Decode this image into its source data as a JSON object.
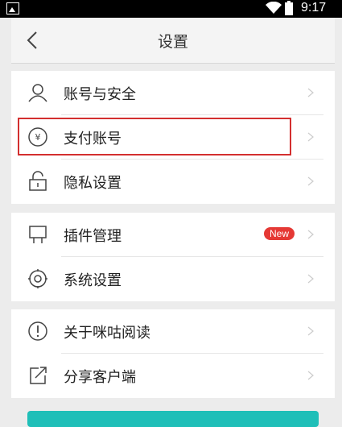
{
  "status_bar": {
    "time": "9:17"
  },
  "header": {
    "title": "设置"
  },
  "groups": [
    {
      "items": [
        {
          "label": "账号与安全",
          "icon": "user-icon"
        },
        {
          "label": "支付账号",
          "icon": "yen-icon"
        },
        {
          "label": "隐私设置",
          "icon": "unlock-icon"
        }
      ]
    },
    {
      "items": [
        {
          "label": "插件管理",
          "icon": "plugin-icon",
          "badge": "New"
        },
        {
          "label": "系统设置",
          "icon": "settings-icon"
        }
      ]
    },
    {
      "items": [
        {
          "label": "关于咪咕阅读",
          "icon": "info-icon"
        },
        {
          "label": "分享客户端",
          "icon": "share-icon"
        }
      ]
    }
  ],
  "colors": {
    "accent_button": "#1fbfb8",
    "highlight_box": "#d32f2f",
    "badge": "#e53935"
  }
}
